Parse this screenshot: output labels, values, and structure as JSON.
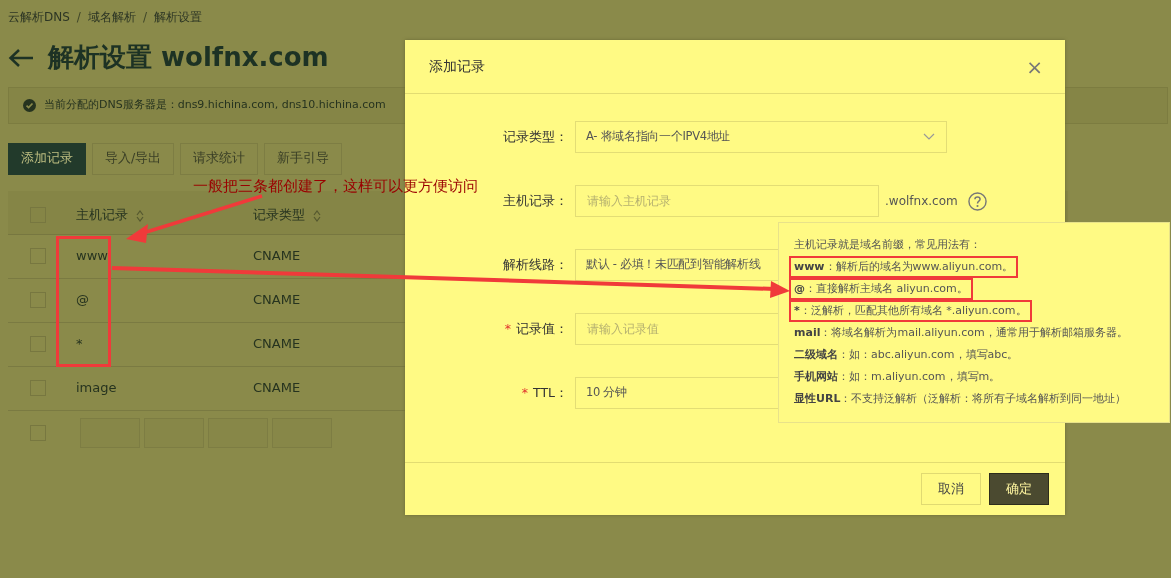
{
  "breadcrumb": {
    "separator": "/",
    "items": [
      "云解析DNS",
      "域名解析",
      "解析设置"
    ]
  },
  "page_title": "解析设置 wolfnx.com",
  "notice": "当前分配的DNS服务器是：dns9.hichina.com, dns10.hichina.com",
  "toolbar": [
    {
      "label": "添加记录",
      "kind": "primary"
    },
    {
      "label": "导入/导出",
      "kind": "default"
    },
    {
      "label": "请求统计",
      "kind": "default"
    },
    {
      "label": "新手引导",
      "kind": "default"
    }
  ],
  "table": {
    "header_checked": false,
    "footer_checked": false,
    "columns": [
      "主机记录",
      "记录类型"
    ],
    "rows": [
      {
        "host": "www",
        "type": "CNAME",
        "checked": false,
        "highlighted": true
      },
      {
        "host": "@",
        "type": "CNAME",
        "checked": false,
        "highlighted": true
      },
      {
        "host": "*",
        "type": "CNAME",
        "checked": false,
        "highlighted": true
      },
      {
        "host": "image",
        "type": "CNAME",
        "checked": false,
        "highlighted": false
      }
    ]
  },
  "modal": {
    "title": "添加记录",
    "close": "×",
    "fields": [
      {
        "label": "记录类型：",
        "required": false,
        "kind": "select",
        "value": "A- 将域名指向一个IPV4地址"
      },
      {
        "label": "主机记录：",
        "required": false,
        "kind": "input",
        "placeholder": "请输入主机记录",
        "suffix": ".wolfnx.com",
        "help": true
      },
      {
        "label": "解析线路：",
        "required": false,
        "kind": "select",
        "value": "默认 - 必填！未匹配到智能解析线"
      },
      {
        "label": "记录值：",
        "required": true,
        "kind": "input",
        "placeholder": "请输入记录值"
      },
      {
        "label": "TTL：",
        "required": true,
        "kind": "select",
        "value": "10 分钟"
      }
    ],
    "buttons": [
      {
        "label": "取消",
        "kind": "default"
      },
      {
        "label": "确定",
        "kind": "primary"
      }
    ]
  },
  "tooltip": {
    "intro": "主机记录就是域名前缀，常见用法有：",
    "lines": [
      {
        "text": "**www**：解析后的域名为www.aliyun.com。",
        "highlighted": true
      },
      {
        "text": "**@**：直接解析主域名 aliyun.com。",
        "highlighted": true
      },
      {
        "text": "*****：泛解析，匹配其他所有域名 *.aliyun.com。",
        "highlighted": true
      },
      {
        "text": "**mail**：将域名解析为mail.aliyun.com，通常用于解析邮箱服务器。",
        "highlighted": false
      },
      {
        "text": "**二级域名**：如：abc.aliyun.com，填写abc。",
        "highlighted": false
      },
      {
        "text": "**手机网站**：如：m.aliyun.com，填写m。",
        "highlighted": false
      },
      {
        "text": "**显性URL**：不支持泛解析（泛解析：将所有子域名解析到同一地址）",
        "highlighted": false
      }
    ]
  },
  "annotation": {
    "text": "一般把三条都创建了，这样可以更方便访问"
  }
}
